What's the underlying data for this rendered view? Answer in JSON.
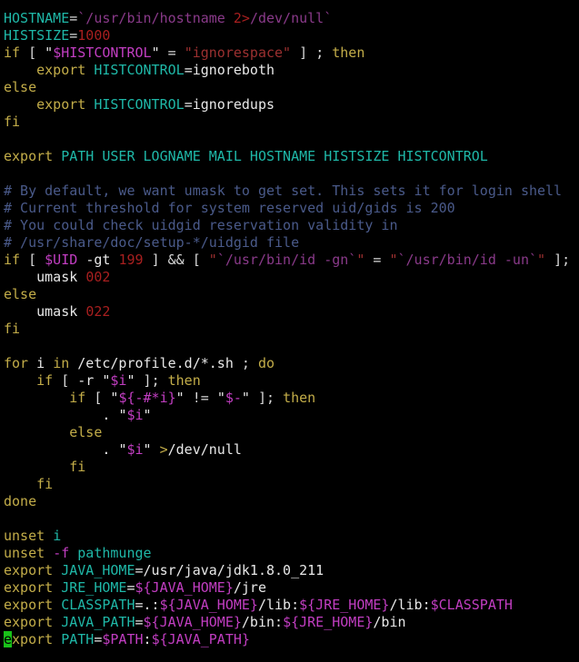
{
  "terminal": {
    "title": "terminal",
    "background": "#000000",
    "cols": 70,
    "rows": 38,
    "font_size_px": 15,
    "line_height_px": 19,
    "cursor": {
      "visible": true,
      "shape": "block",
      "color": "#19c119",
      "line": 37,
      "column": 0,
      "char": "e"
    },
    "palette": {
      "plain": "#e8e8e8",
      "variable": "#1fb8a8",
      "keyword": "#c3ad49",
      "number": "#a81f1f",
      "string": "#9c3030",
      "dollar_expansion": "#c23ec2",
      "comment": "#4a5a8a",
      "command_substitution": "#8a3a8a",
      "redirect": "#c3ad49",
      "flag": "#c23ec2",
      "punctuation": "#d8d8d8"
    }
  },
  "content": {
    "plain_text": "HOSTNAME=`/usr/bin/hostname 2>/dev/null`\nHISTSIZE=1000\nif [ \"$HISTCONTROL\" = \"ignorespace\" ] ; then\n    export HISTCONTROL=ignoreboth\nelse\n    export HISTCONTROL=ignoredups\nfi\n\nexport PATH USER LOGNAME MAIL HOSTNAME HISTSIZE HISTCONTROL\n\n# By default, we want umask to get set. This sets it for login shell\n# Current threshold for system reserved uid/gids is 200\n# You could check uidgid reservation validity in\n# /usr/share/doc/setup-*/uidgid file\nif [ $UID -gt 199 ] && [ \"`/usr/bin/id -gn`\" = \"`/usr/bin/id -un`\" ]; then\n    umask 002\nelse\n    umask 022\nfi\n\nfor i in /etc/profile.d/*.sh ; do\n    if [ -r \"$i\" ]; then\n        if [ \"${-#*i}\" != \"$-\" ]; then\n            . \"$i\"\n        else\n            . \"$i\" >/dev/null\n        fi\n    fi\ndone\n\nunset i\nunset -f pathmunge\nexport JAVA_HOME=/usr/java/jdk1.8.0_211\nexport JRE_HOME=${JAVA_HOME}/jre\nexport CLASSPATH=.:${JAVA_HOME}/lib:${JRE_HOME}/lib:$CLASSPATH\nexport JAVA_PATH=${JAVA_HOME}/bin:${JRE_HOME}/bin\nexport PATH=$PATH:${JAVA_PATH}",
    "lines": [
      {
        "n": 1,
        "tokens": [
          {
            "t": "HOSTNAME",
            "c": "var"
          },
          {
            "t": "=",
            "c": "punct"
          },
          {
            "t": "`/usr/bin/hostname ",
            "c": "cmdsub"
          },
          {
            "t": "2",
            "c": "num"
          },
          {
            "t": ">",
            "c": "num"
          },
          {
            "t": "/dev/null`",
            "c": "cmdsub"
          }
        ]
      },
      {
        "n": 2,
        "tokens": [
          {
            "t": "HISTSIZE",
            "c": "var"
          },
          {
            "t": "=",
            "c": "punct"
          },
          {
            "t": "1000",
            "c": "num"
          }
        ]
      },
      {
        "n": 3,
        "tokens": [
          {
            "t": "if",
            "c": "kw"
          },
          {
            "t": " ",
            "c": "plain"
          },
          {
            "t": "[",
            "c": "punct"
          },
          {
            "t": " ",
            "c": "plain"
          },
          {
            "t": "\"",
            "c": "plain"
          },
          {
            "t": "$HISTCONTROL",
            "c": "dollar"
          },
          {
            "t": "\"",
            "c": "plain"
          },
          {
            "t": " ",
            "c": "plain"
          },
          {
            "t": "=",
            "c": "punct"
          },
          {
            "t": " ",
            "c": "plain"
          },
          {
            "t": "\"ignorespace\"",
            "c": "str"
          },
          {
            "t": " ",
            "c": "plain"
          },
          {
            "t": "]",
            "c": "punct"
          },
          {
            "t": " ",
            "c": "plain"
          },
          {
            "t": ";",
            "c": "punct"
          },
          {
            "t": " ",
            "c": "plain"
          },
          {
            "t": "then",
            "c": "kw"
          }
        ]
      },
      {
        "n": 4,
        "tokens": [
          {
            "t": "    ",
            "c": "plain"
          },
          {
            "t": "export",
            "c": "kw"
          },
          {
            "t": " ",
            "c": "plain"
          },
          {
            "t": "HISTCONTROL",
            "c": "var"
          },
          {
            "t": "=ignoreboth",
            "c": "plain"
          }
        ]
      },
      {
        "n": 5,
        "tokens": [
          {
            "t": "else",
            "c": "kw"
          }
        ]
      },
      {
        "n": 6,
        "tokens": [
          {
            "t": "    ",
            "c": "plain"
          },
          {
            "t": "export",
            "c": "kw"
          },
          {
            "t": " ",
            "c": "plain"
          },
          {
            "t": "HISTCONTROL",
            "c": "var"
          },
          {
            "t": "=ignoredups",
            "c": "plain"
          }
        ]
      },
      {
        "n": 7,
        "tokens": [
          {
            "t": "fi",
            "c": "kw"
          }
        ]
      },
      {
        "n": 8,
        "tokens": []
      },
      {
        "n": 9,
        "tokens": [
          {
            "t": "export",
            "c": "kw"
          },
          {
            "t": " ",
            "c": "plain"
          },
          {
            "t": "PATH USER LOGNAME MAIL HOSTNAME HISTSIZE HISTCONTROL",
            "c": "var"
          }
        ]
      },
      {
        "n": 10,
        "tokens": []
      },
      {
        "n": 11,
        "tokens": [
          {
            "t": "# By default, we want umask to get set. This sets it for login shell",
            "c": "comment"
          }
        ]
      },
      {
        "n": 12,
        "tokens": [
          {
            "t": "# Current threshold for system reserved uid/gids is 200",
            "c": "comment"
          }
        ]
      },
      {
        "n": 13,
        "tokens": [
          {
            "t": "# You could check uidgid reservation validity in",
            "c": "comment"
          }
        ]
      },
      {
        "n": 14,
        "tokens": [
          {
            "t": "# /usr/share/doc/setup-*/uidgid file",
            "c": "comment"
          }
        ]
      },
      {
        "n": 15,
        "tokens": [
          {
            "t": "if",
            "c": "kw"
          },
          {
            "t": " ",
            "c": "plain"
          },
          {
            "t": "[",
            "c": "punct"
          },
          {
            "t": " ",
            "c": "plain"
          },
          {
            "t": "$UID",
            "c": "dollar"
          },
          {
            "t": " ",
            "c": "plain"
          },
          {
            "t": "-gt",
            "c": "plain"
          },
          {
            "t": " ",
            "c": "plain"
          },
          {
            "t": "199",
            "c": "num"
          },
          {
            "t": " ",
            "c": "plain"
          },
          {
            "t": "]",
            "c": "punct"
          },
          {
            "t": " ",
            "c": "plain"
          },
          {
            "t": "&&",
            "c": "punct"
          },
          {
            "t": " ",
            "c": "plain"
          },
          {
            "t": "[",
            "c": "punct"
          },
          {
            "t": " ",
            "c": "plain"
          },
          {
            "t": "\"",
            "c": "str"
          },
          {
            "t": "`/usr/bin/id -gn`",
            "c": "cmdsub"
          },
          {
            "t": "\"",
            "c": "str"
          },
          {
            "t": " ",
            "c": "plain"
          },
          {
            "t": "=",
            "c": "punct"
          },
          {
            "t": " ",
            "c": "plain"
          },
          {
            "t": "\"",
            "c": "str"
          },
          {
            "t": "`/usr/bin/id -un`",
            "c": "cmdsub"
          },
          {
            "t": "\"",
            "c": "str"
          },
          {
            "t": " ",
            "c": "plain"
          },
          {
            "t": "]",
            "c": "punct"
          },
          {
            "t": ";",
            "c": "punct"
          },
          {
            "t": " ",
            "c": "plain"
          },
          {
            "t": "then",
            "c": "kw"
          }
        ]
      },
      {
        "n": 16,
        "tokens": [
          {
            "t": "    ",
            "c": "plain"
          },
          {
            "t": "umask",
            "c": "plain"
          },
          {
            "t": " ",
            "c": "plain"
          },
          {
            "t": "002",
            "c": "num"
          }
        ]
      },
      {
        "n": 17,
        "tokens": [
          {
            "t": "else",
            "c": "kw"
          }
        ]
      },
      {
        "n": 18,
        "tokens": [
          {
            "t": "    ",
            "c": "plain"
          },
          {
            "t": "umask",
            "c": "plain"
          },
          {
            "t": " ",
            "c": "plain"
          },
          {
            "t": "022",
            "c": "num"
          }
        ]
      },
      {
        "n": 19,
        "tokens": [
          {
            "t": "fi",
            "c": "kw"
          }
        ]
      },
      {
        "n": 20,
        "tokens": []
      },
      {
        "n": 21,
        "tokens": [
          {
            "t": "for",
            "c": "kw"
          },
          {
            "t": " ",
            "c": "plain"
          },
          {
            "t": "i",
            "c": "plain"
          },
          {
            "t": " ",
            "c": "plain"
          },
          {
            "t": "in",
            "c": "kw"
          },
          {
            "t": " ",
            "c": "plain"
          },
          {
            "t": "/etc/profile.d/*.sh",
            "c": "plain"
          },
          {
            "t": " ",
            "c": "plain"
          },
          {
            "t": ";",
            "c": "punct"
          },
          {
            "t": " ",
            "c": "plain"
          },
          {
            "t": "do",
            "c": "kw"
          }
        ]
      },
      {
        "n": 22,
        "tokens": [
          {
            "t": "    ",
            "c": "plain"
          },
          {
            "t": "if",
            "c": "kw"
          },
          {
            "t": " ",
            "c": "plain"
          },
          {
            "t": "[",
            "c": "punct"
          },
          {
            "t": " ",
            "c": "plain"
          },
          {
            "t": "-r",
            "c": "plain"
          },
          {
            "t": " ",
            "c": "plain"
          },
          {
            "t": "\"",
            "c": "plain"
          },
          {
            "t": "$i",
            "c": "dollar"
          },
          {
            "t": "\"",
            "c": "plain"
          },
          {
            "t": " ",
            "c": "plain"
          },
          {
            "t": "]",
            "c": "punct"
          },
          {
            "t": ";",
            "c": "punct"
          },
          {
            "t": " ",
            "c": "plain"
          },
          {
            "t": "then",
            "c": "kw"
          }
        ]
      },
      {
        "n": 23,
        "tokens": [
          {
            "t": "        ",
            "c": "plain"
          },
          {
            "t": "if",
            "c": "kw"
          },
          {
            "t": " ",
            "c": "plain"
          },
          {
            "t": "[",
            "c": "punct"
          },
          {
            "t": " ",
            "c": "plain"
          },
          {
            "t": "\"",
            "c": "plain"
          },
          {
            "t": "${-#*i}",
            "c": "dollar"
          },
          {
            "t": "\"",
            "c": "plain"
          },
          {
            "t": " ",
            "c": "plain"
          },
          {
            "t": "!=",
            "c": "punct"
          },
          {
            "t": " ",
            "c": "plain"
          },
          {
            "t": "\"",
            "c": "plain"
          },
          {
            "t": "$-",
            "c": "dollar"
          },
          {
            "t": "\"",
            "c": "plain"
          },
          {
            "t": " ",
            "c": "plain"
          },
          {
            "t": "]",
            "c": "punct"
          },
          {
            "t": ";",
            "c": "punct"
          },
          {
            "t": " ",
            "c": "plain"
          },
          {
            "t": "then",
            "c": "kw"
          }
        ]
      },
      {
        "n": 24,
        "tokens": [
          {
            "t": "            ",
            "c": "plain"
          },
          {
            "t": ".",
            "c": "plain"
          },
          {
            "t": " ",
            "c": "plain"
          },
          {
            "t": "\"",
            "c": "plain"
          },
          {
            "t": "$i",
            "c": "dollar"
          },
          {
            "t": "\"",
            "c": "plain"
          }
        ]
      },
      {
        "n": 25,
        "tokens": [
          {
            "t": "        ",
            "c": "plain"
          },
          {
            "t": "else",
            "c": "kw"
          }
        ]
      },
      {
        "n": 26,
        "tokens": [
          {
            "t": "            ",
            "c": "plain"
          },
          {
            "t": ".",
            "c": "plain"
          },
          {
            "t": " ",
            "c": "plain"
          },
          {
            "t": "\"",
            "c": "plain"
          },
          {
            "t": "$i",
            "c": "dollar"
          },
          {
            "t": "\"",
            "c": "plain"
          },
          {
            "t": " ",
            "c": "plain"
          },
          {
            "t": ">",
            "c": "redir"
          },
          {
            "t": "/dev/null",
            "c": "plain"
          }
        ]
      },
      {
        "n": 27,
        "tokens": [
          {
            "t": "        ",
            "c": "plain"
          },
          {
            "t": "fi",
            "c": "kw"
          }
        ]
      },
      {
        "n": 28,
        "tokens": [
          {
            "t": "    ",
            "c": "plain"
          },
          {
            "t": "fi",
            "c": "kw"
          }
        ]
      },
      {
        "n": 29,
        "tokens": [
          {
            "t": "done",
            "c": "kw"
          }
        ]
      },
      {
        "n": 30,
        "tokens": []
      },
      {
        "n": 31,
        "tokens": [
          {
            "t": "unset",
            "c": "kw"
          },
          {
            "t": " ",
            "c": "plain"
          },
          {
            "t": "i",
            "c": "var"
          }
        ]
      },
      {
        "n": 32,
        "tokens": [
          {
            "t": "unset",
            "c": "kw"
          },
          {
            "t": " ",
            "c": "plain"
          },
          {
            "t": "-f",
            "c": "flag"
          },
          {
            "t": " ",
            "c": "plain"
          },
          {
            "t": "pathmunge",
            "c": "var"
          }
        ]
      },
      {
        "n": 33,
        "tokens": [
          {
            "t": "export",
            "c": "kw"
          },
          {
            "t": " ",
            "c": "plain"
          },
          {
            "t": "JAVA_HOME",
            "c": "var"
          },
          {
            "t": "=/usr/java/jdk1.8.0_211",
            "c": "plain"
          }
        ]
      },
      {
        "n": 34,
        "tokens": [
          {
            "t": "export",
            "c": "kw"
          },
          {
            "t": " ",
            "c": "plain"
          },
          {
            "t": "JRE_HOME",
            "c": "var"
          },
          {
            "t": "=",
            "c": "plain"
          },
          {
            "t": "${JAVA_HOME}",
            "c": "dollar"
          },
          {
            "t": "/jre",
            "c": "plain"
          }
        ]
      },
      {
        "n": 35,
        "tokens": [
          {
            "t": "export",
            "c": "kw"
          },
          {
            "t": " ",
            "c": "plain"
          },
          {
            "t": "CLASSPATH",
            "c": "var"
          },
          {
            "t": "=.:",
            "c": "plain"
          },
          {
            "t": "${JAVA_HOME}",
            "c": "dollar"
          },
          {
            "t": "/lib:",
            "c": "plain"
          },
          {
            "t": "${JRE_HOME}",
            "c": "dollar"
          },
          {
            "t": "/lib:",
            "c": "plain"
          },
          {
            "t": "$CLASSPATH",
            "c": "dollar"
          }
        ]
      },
      {
        "n": 36,
        "tokens": [
          {
            "t": "export",
            "c": "kw"
          },
          {
            "t": " ",
            "c": "plain"
          },
          {
            "t": "JAVA_PATH",
            "c": "var"
          },
          {
            "t": "=",
            "c": "plain"
          },
          {
            "t": "${JAVA_HOME}",
            "c": "dollar"
          },
          {
            "t": "/bin:",
            "c": "plain"
          },
          {
            "t": "${JRE_HOME}",
            "c": "dollar"
          },
          {
            "t": "/bin",
            "c": "plain"
          }
        ]
      },
      {
        "n": 37,
        "tokens": [
          {
            "t": "e",
            "c": "kw",
            "cursor": true
          },
          {
            "t": "xport",
            "c": "kw"
          },
          {
            "t": " ",
            "c": "plain"
          },
          {
            "t": "PATH",
            "c": "var"
          },
          {
            "t": "=",
            "c": "plain"
          },
          {
            "t": "$PATH",
            "c": "dollar"
          },
          {
            "t": ":",
            "c": "plain"
          },
          {
            "t": "${JAVA_PATH}",
            "c": "dollar"
          }
        ]
      }
    ]
  }
}
